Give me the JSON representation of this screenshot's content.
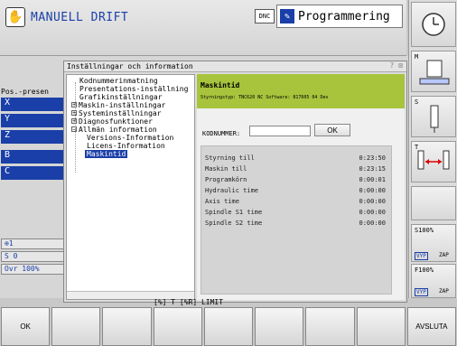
{
  "header": {
    "mode_left": "MANUELL DRIFT",
    "dnc": "DNC",
    "mode_right": "Programmering"
  },
  "left": {
    "pos_label": "Pos.-presen",
    "axes": [
      "X",
      "Y",
      "Z",
      "B",
      "C"
    ],
    "status": [
      "S 0",
      "Ovr 100%"
    ],
    "tool_label": "1"
  },
  "dialog": {
    "title": "Inställningar och information",
    "close": "? ⊠",
    "tree": [
      {
        "label": "Kodnummerinmatning",
        "expander": ""
      },
      {
        "label": "Presentations-inställning",
        "expander": ""
      },
      {
        "label": "Grafikinställningar",
        "expander": ""
      },
      {
        "label": "Maskin-inställningar",
        "expander": "+"
      },
      {
        "label": "Systeminställningar",
        "expander": "+"
      },
      {
        "label": "Diagnosfunktioner",
        "expander": "+"
      },
      {
        "label": "Allmän information",
        "expander": "−"
      },
      {
        "label": "Versions-Information",
        "expander": ""
      },
      {
        "label": "Licens-Information",
        "expander": ""
      },
      {
        "label": "Maskintid",
        "expander": ""
      }
    ],
    "panel": {
      "title": "Maskintid",
      "subtitle": "Styrningstyp: TNC620     NC Software: 817605 04 Dev",
      "code_label": "KODNUMMER:",
      "code_value": "",
      "ok": "OK",
      "rows": [
        {
          "label": "Styrning till",
          "value": "0:23:50"
        },
        {
          "label": "Maskin till",
          "value": "0:23:15"
        },
        {
          "label": "Programkörn",
          "value": "0:00:01"
        },
        {
          "label": "Hydraulic time",
          "value": "0:00:00"
        },
        {
          "label": "Axis time",
          "value": "0:00:00"
        },
        {
          "label": "Spindle S1 time",
          "value": "0:00:00"
        },
        {
          "label": "Spindle S2 time",
          "value": "0:00:00"
        }
      ]
    }
  },
  "right": {
    "m_label": "M",
    "s_label": "S",
    "t_label": "T",
    "s100": "S100%",
    "f100": "F100%",
    "vyp1": "VYP",
    "zap1": "ZAP",
    "vyp2": "VYP",
    "zap2": "ZAP"
  },
  "hint": "[%] T  [%R]  LIMIT",
  "softkeys": [
    "OK",
    "",
    "",
    "",
    "",
    "",
    "",
    "",
    "AVSLUTA"
  ]
}
